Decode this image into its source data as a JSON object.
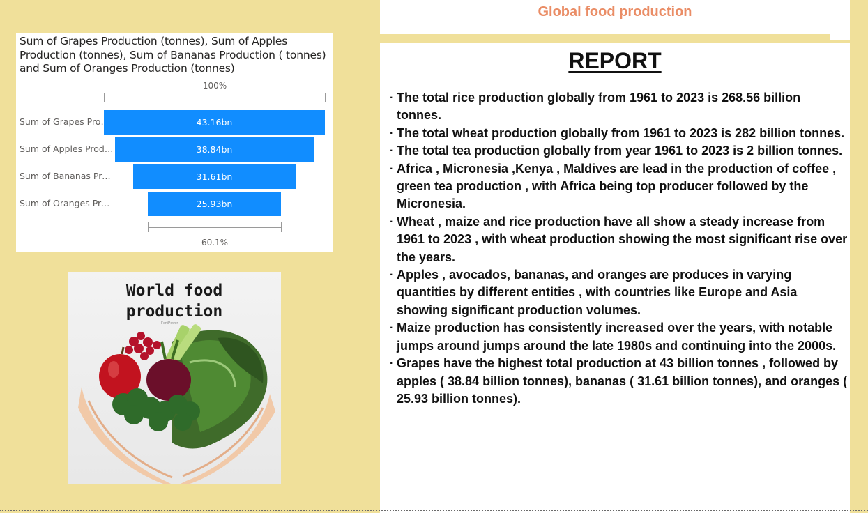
{
  "header": {
    "title": "Global food production"
  },
  "funnel": {
    "title": "Sum of Grapes Production (tonnes), Sum of Apples Production (tonnes), Sum of Bananas Production ( tonnes) and Sum of Oranges Production (tonnes)",
    "top_percent": "100%",
    "bottom_percent": "60.1%",
    "accent_color": "#118dff"
  },
  "chart_data": {
    "type": "bar",
    "title": "Sum of Grapes Production (tonnes), Sum of Apples Production (tonnes), Sum of Bananas Production ( tonnes) and Sum of Oranges Production (tonnes)",
    "categories": [
      "Sum of Grapes Prod...",
      "Sum of Apples Produ...",
      "Sum of Bananas Pro...",
      "Sum of Oranges Pro..."
    ],
    "values": [
      43.16,
      38.84,
      31.61,
      25.93
    ],
    "value_labels": [
      "43.16bn",
      "38.84bn",
      "31.61bn",
      "25.93bn"
    ],
    "top_label": "100%",
    "bottom_label": "60.1%"
  },
  "image": {
    "title_line1": "World food",
    "title_line2": "production",
    "credit": "FertiPower"
  },
  "report": {
    "title": "REPORT",
    "items": [
      "The total rice production globally from 1961 to 2023 is 268.56 billion tonnes.",
      "The total wheat production globally from 1961 to 2023 is 282 billion tonnes.",
      "The total tea production globally from year 1961 to 2023 is 2 billion tonnes.",
      "Africa , Micronesia ,Kenya , Maldives are lead in the production of coffee , green tea production , with Africa being top producer followed by the Micronesia.",
      "Wheat , maize and rice production have all show a steady increase from 1961 to 2023 , with wheat production showing the most significant rise over the years.",
      "Apples , avocados, bananas, and oranges are produces in varying quantities by different entities , with countries like Europe and  Asia showing significant production volumes.",
      "Maize production has consistently increased over the years, with notable jumps around jumps around the late 1980s and continuing into the 2000s.",
      "Grapes have the highest total production at 43 billion tonnes , followed by apples ( 38.84 billion tonnes), bananas ( 31.61 billion tonnes), and oranges    ( 25.93 billion tonnes)."
    ]
  }
}
